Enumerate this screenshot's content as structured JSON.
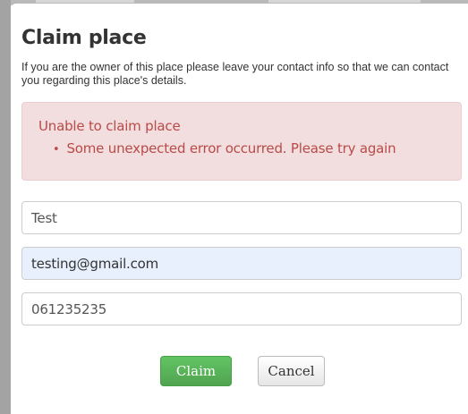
{
  "modal": {
    "title": "Claim place",
    "description": "If you are the owner of this place please leave your contact info so that we can contact you regarding this place's details."
  },
  "alert": {
    "heading": "Unable to claim place",
    "errors": [
      "Some unexpected error occurred. Please try again"
    ],
    "color": "#b94a48",
    "background": "#f2dede"
  },
  "form": {
    "name_value": "Test",
    "email_value": "testing@gmail.com",
    "phone_value": "061235235"
  },
  "buttons": {
    "claim_label": "Claim",
    "cancel_label": "Cancel",
    "claim_color": "#5bb75b"
  }
}
